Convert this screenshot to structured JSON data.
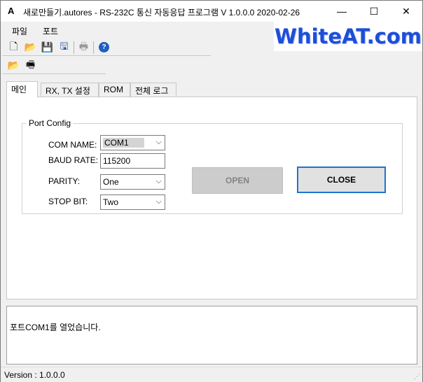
{
  "window": {
    "app_icon": "A",
    "title": "새로만들기.autores - RS-232C 통신 자동응답 프로그램  V 1.0.0.0 2020-02-26",
    "minimize_glyph": "—",
    "maximize_glyph": "☐",
    "close_glyph": "✕"
  },
  "menu": {
    "file": "파일",
    "port": "포트"
  },
  "logo": {
    "text": "WhiteAT.com"
  },
  "toolbar": {
    "new_icon": "🗋",
    "open_icon": "📂",
    "save_icon": "💾",
    "save_as_icon": "🖫",
    "print_icon": "🖶",
    "help_icon": "?",
    "open_port_icon": "📂",
    "port_icon": "🖷"
  },
  "tabs": [
    {
      "label": "메인"
    },
    {
      "label": "RX, TX 설정"
    },
    {
      "label": "ROM"
    },
    {
      "label": "전체 로그"
    }
  ],
  "port_config": {
    "title": "Port Config",
    "com_name_label": "COM NAME:",
    "com_name_value": "COM1",
    "baud_rate_label": "BAUD RATE:",
    "baud_rate_value": "115200",
    "parity_label": "PARITY:",
    "parity_value": "One",
    "stop_bit_label": "STOP BIT:",
    "stop_bit_value": "Two",
    "open_button": "OPEN",
    "close_button": "CLOSE",
    "chevron": "⌵"
  },
  "log": {
    "line": "포트COM1를 열었습니다."
  },
  "status": {
    "version": "Version : 1.0.0.0",
    "grip": "⋰"
  },
  "colors": {
    "accent": "#1e74d0",
    "logo": "#1e4ed8",
    "disabled_button": "#cccccc"
  }
}
